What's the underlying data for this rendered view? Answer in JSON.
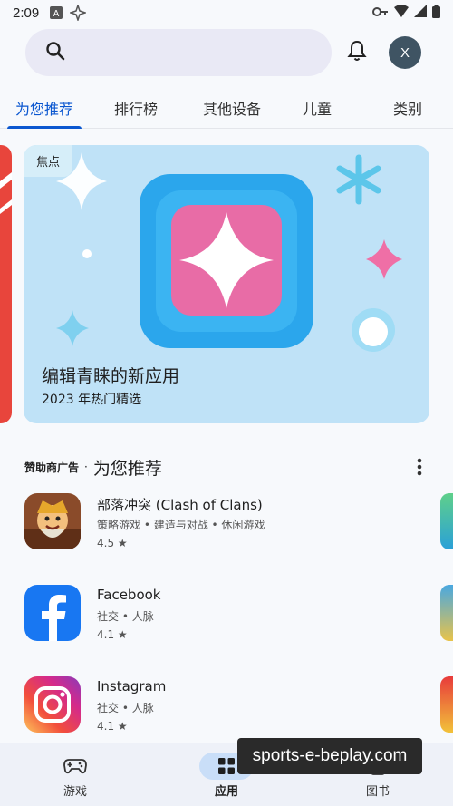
{
  "status_bar": {
    "time": "2:09"
  },
  "header": {
    "avatar_initial": "X"
  },
  "tabs": [
    {
      "label": "为您推荐"
    },
    {
      "label": "排行榜"
    },
    {
      "label": "其他设备"
    },
    {
      "label": "儿童"
    },
    {
      "label": "类别"
    }
  ],
  "feature": {
    "badge": "焦点",
    "title": "编辑青睐的新应用",
    "subtitle": "2023 年热门精选"
  },
  "section": {
    "ad_label": "赞助商广告",
    "separator": "·",
    "title": "为您推荐"
  },
  "apps": [
    {
      "name": "部落冲突 (Clash of Clans)",
      "categories": "策略游戏 • 建造与对战 • 休闲游戏",
      "rating": "4.5"
    },
    {
      "name": "Facebook",
      "categories": "社交 • 人脉",
      "rating": "4.1"
    },
    {
      "name": "Instagram",
      "categories": "社交 • 人脉",
      "rating": "4.1"
    }
  ],
  "bottom_nav": [
    {
      "label": "游戏"
    },
    {
      "label": "应用"
    },
    {
      "label": "图书"
    }
  ],
  "watermark": "sports-e-beplay.com",
  "colors": {
    "accent": "#0b57d0",
    "feature_bg": "#bfe2f7",
    "nav_active": "#c9def8"
  }
}
